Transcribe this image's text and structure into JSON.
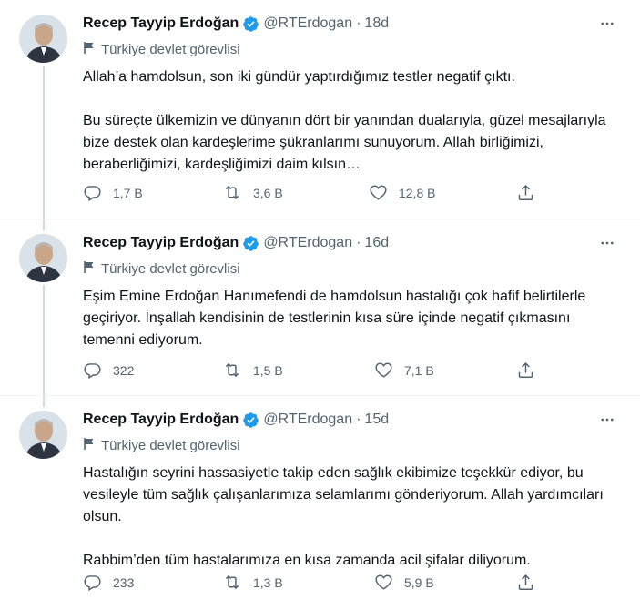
{
  "tweets": [
    {
      "name": "Recep Tayyip Erdoğan",
      "handle": "@RTErdogan",
      "separator": "·",
      "time": "18d",
      "label": "Türkiye devlet görevlisi",
      "text": "Allah’a hamdolsun, son iki gündür yaptırdığımız testler negatif çıktı.\n\nBu süreçte ülkemizin ve dünyanın dört bir yanından dualarıyla, güzel mesajlarıyla bize destek olan kardeşlerime şükranlarımı sunuyorum. Allah birliğimizi, beraberliğimizi, kardeşliğimizi daim kılsın…",
      "replies": "1,7 B",
      "retweets": "3,6 B",
      "likes": "12,8 B"
    },
    {
      "name": "Recep Tayyip Erdoğan",
      "handle": "@RTErdogan",
      "separator": "·",
      "time": "16d",
      "label": "Türkiye devlet görevlisi",
      "text": "Eşim Emine Erdoğan Hanımefendi de hamdolsun hastalığı çok hafif belirtilerle geçiriyor. İnşallah kendisinin de testlerinin kısa süre içinde negatif çıkmasını temenni ediyorum.",
      "replies": "322",
      "retweets": "1,5 B",
      "likes": "7,1 B"
    },
    {
      "name": "Recep Tayyip Erdoğan",
      "handle": "@RTErdogan",
      "separator": "·",
      "time": "15d",
      "label": "Türkiye devlet görevlisi",
      "text": "Hastalığın seyrini hassasiyetle takip eden sağlık ekibimize teşekkür ediyor, bu vesileyle tüm sağlık çalışanlarımıza selamlarımı gönderiyorum. Allah yardımcıları olsun.\n\nRabbim’den tüm hastalarımıza en kısa zamanda acil şifalar diliyorum.",
      "replies": "233",
      "retweets": "1,3 B",
      "likes": "5,9 B"
    }
  ],
  "colors": {
    "accent": "#1d9bf0",
    "secondary_text": "#536471",
    "primary_text": "#0f1419",
    "thread_line": "#cfd9de"
  },
  "icons": [
    "verified-badge-icon",
    "more-options-icon",
    "government-flag-icon",
    "reply-icon",
    "retweet-icon",
    "like-icon",
    "share-icon"
  ]
}
